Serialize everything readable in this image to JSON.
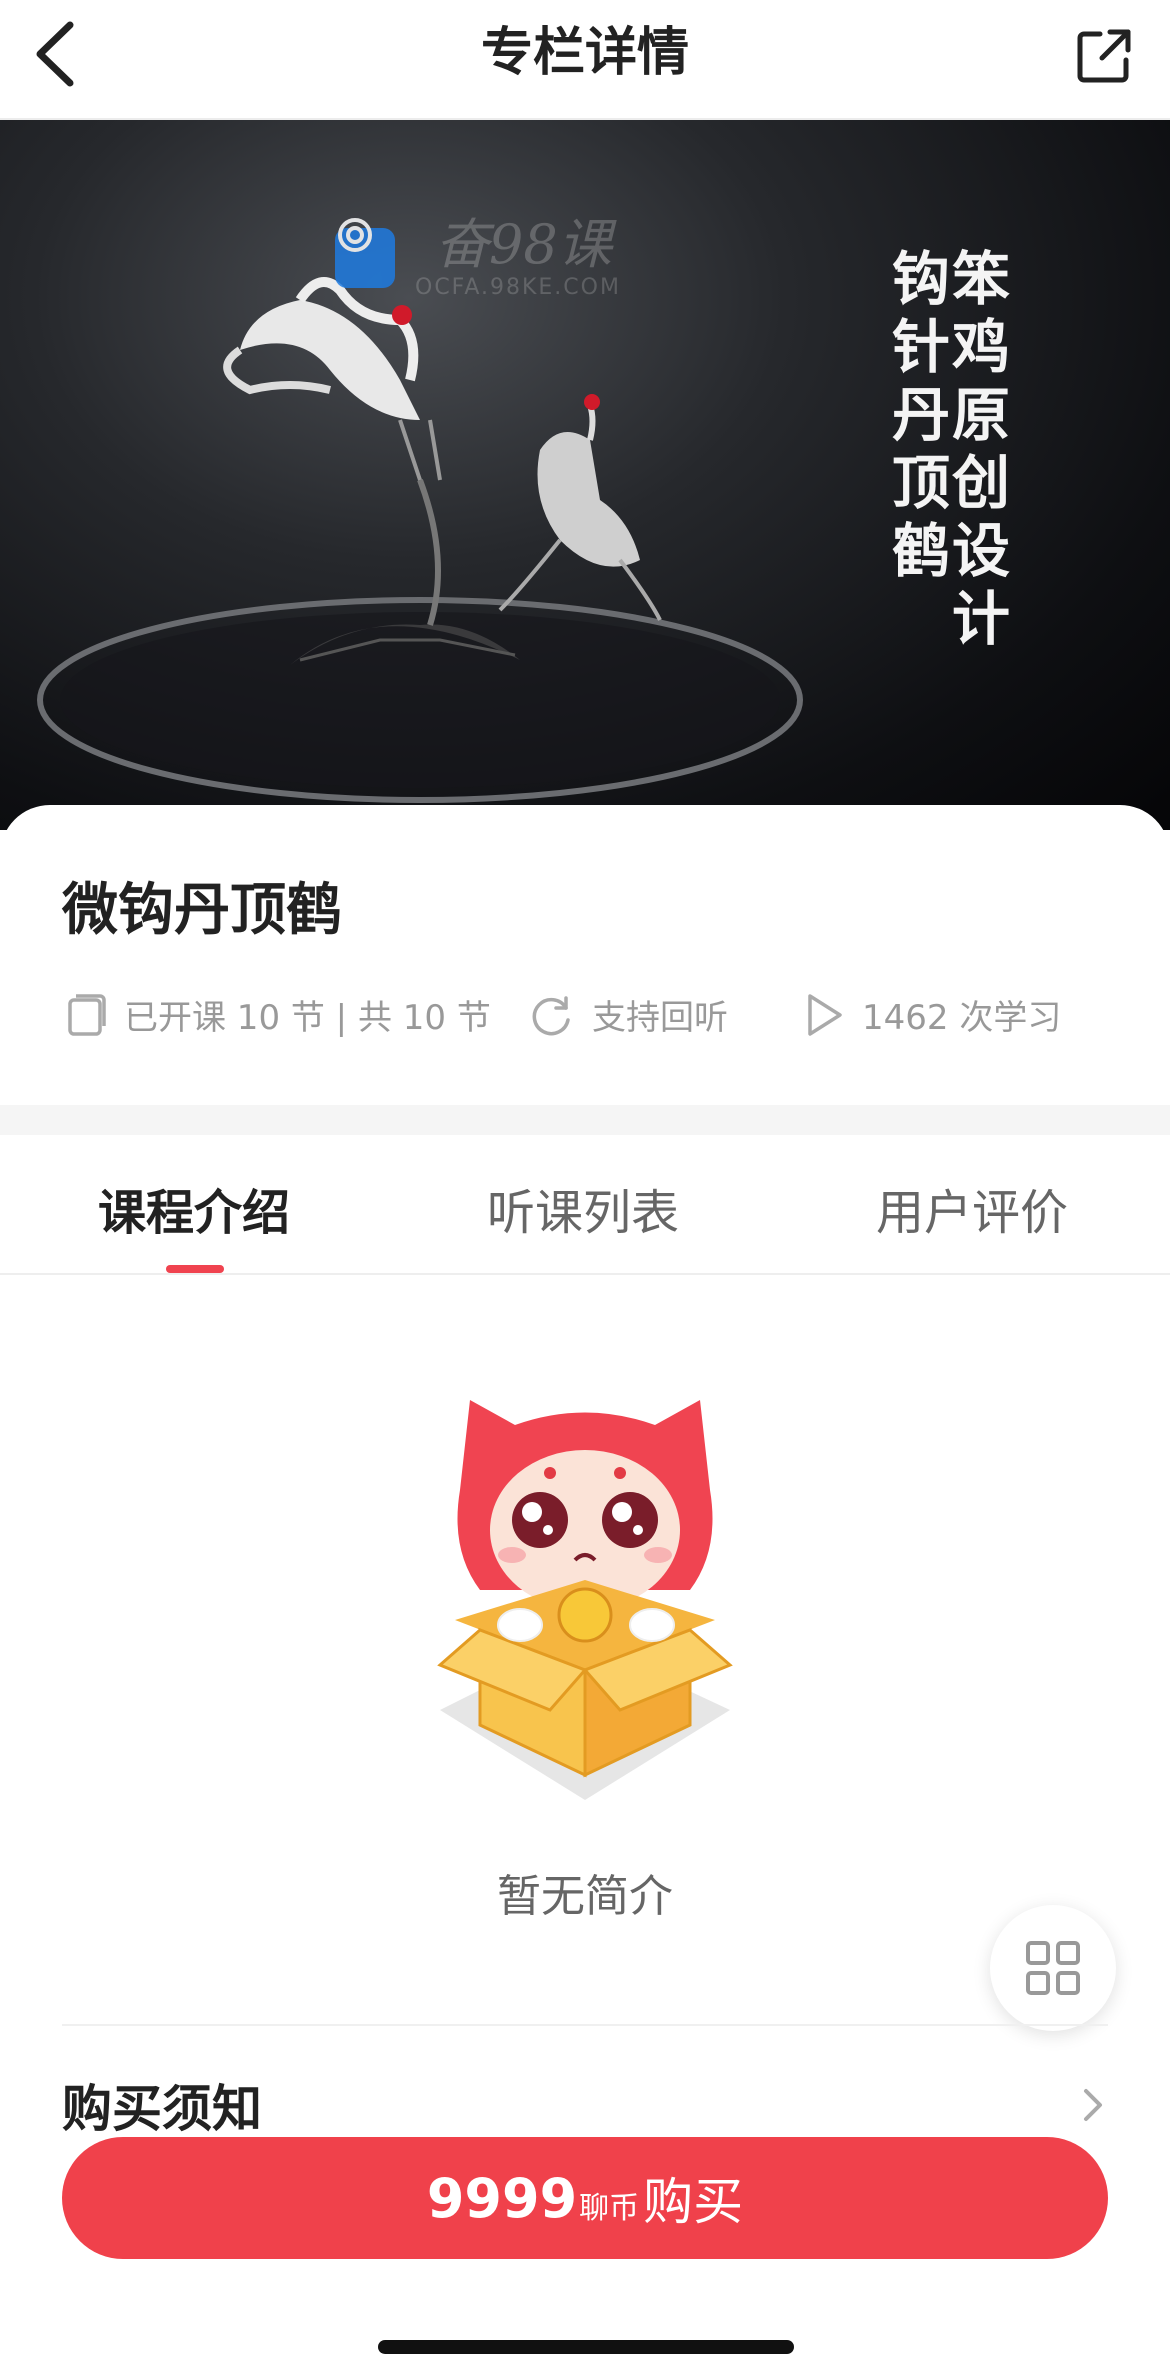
{
  "header": {
    "title": "专栏详情",
    "back_icon": "chevron-left-icon",
    "share_icon": "external-share-icon"
  },
  "hero": {
    "vertical_text_right": "笨鸡原创设计",
    "vertical_text_left": "钩针丹顶鹤",
    "watermark_text": "奋98课",
    "watermark_url": "OCFA.98KE.COM"
  },
  "course": {
    "title": "微钩丹顶鹤",
    "lessons": "已开课 10 节 | 共 10 节",
    "replay": "支持回听",
    "learners": "1462 次学习"
  },
  "tabs": [
    {
      "label": "课程介绍",
      "active": true
    },
    {
      "label": "听课列表",
      "active": false
    },
    {
      "label": "用户评价",
      "active": false
    }
  ],
  "content": {
    "empty_text": "暂无简介"
  },
  "purchase_notice": {
    "label": "购买须知"
  },
  "buy_button": {
    "price": "9999",
    "unit": "聊币",
    "action": "购买"
  },
  "colors": {
    "accent": "#f0414b",
    "tab_indicator": "#f0434f"
  }
}
